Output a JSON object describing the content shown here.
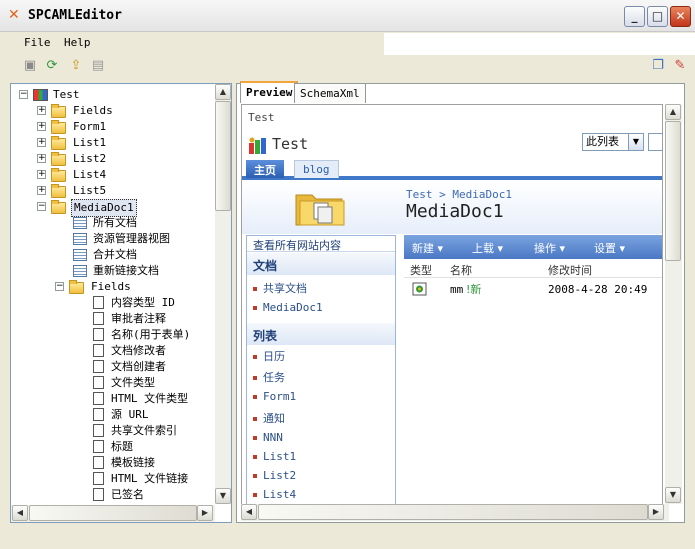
{
  "window": {
    "title": "SPCAMLEditor",
    "minimize": "_",
    "maximize": "□",
    "close": "✕"
  },
  "menu": {
    "file": "File",
    "help": "Help"
  },
  "toolbar": {
    "icons": [
      "save-icon",
      "refresh-icon",
      "export-icon",
      "document-icon",
      "window-icon",
      "eraser-icon"
    ]
  },
  "tree": {
    "root": "Test",
    "items": [
      "Fields",
      "Form1",
      "List1",
      "List2",
      "List4",
      "List5",
      "MediaDoc1"
    ],
    "views": [
      "所有文档",
      "资源管理器视图",
      "合并文档",
      "重新链接文档"
    ],
    "fields_folder": "Fields",
    "fields": [
      "内容类型 ID",
      "审批者注释",
      "名称(用于表单)",
      "文档修改者",
      "文档创建者",
      "文件类型",
      "HTML 文件类型",
      "源 URL",
      "共享文件索引",
      "标题",
      "模板链接",
      "HTML 文件链接",
      "已签名"
    ]
  },
  "tabs": {
    "preview": "Preview",
    "schema": "SchemaXml"
  },
  "web": {
    "breadcrumb": "Test",
    "site_title": "Test",
    "view_select": "此列表",
    "tabs": {
      "home": "主页",
      "blog": "blog"
    },
    "page_crumb": "Test > MediaDoc1",
    "page_title": "MediaDoc1",
    "quicklaunch": {
      "all_content": "查看所有网站内容",
      "docs_head": "文档",
      "docs": [
        "共享文档",
        "MediaDoc1"
      ],
      "lists_head": "列表",
      "lists": [
        "日历",
        "任务",
        "Form1",
        "通知",
        "NNN",
        "List1",
        "List2",
        "List4"
      ]
    },
    "list_toolbar": {
      "new": "新建 ▾",
      "upload": "上载 ▾",
      "actions": "操作 ▾",
      "settings": "设置 ▾"
    },
    "columns": {
      "type": "类型",
      "name": "名称",
      "modified": "修改时间"
    },
    "rows": [
      {
        "name": "mm",
        "new_badge": "!新",
        "modified": "2008-4-28 20:49"
      }
    ]
  }
}
